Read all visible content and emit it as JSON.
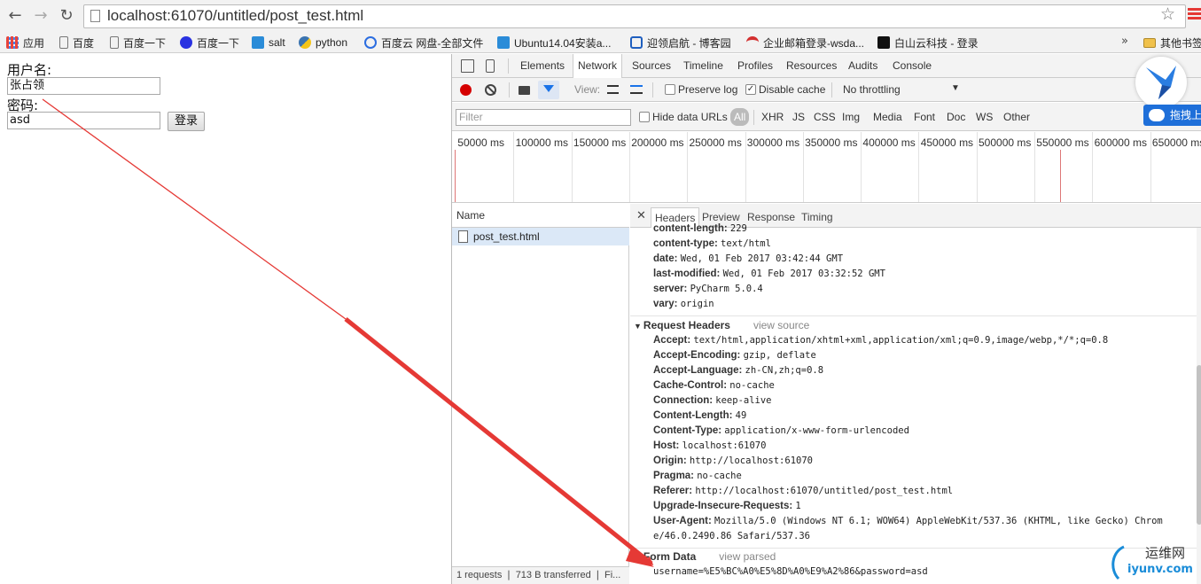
{
  "browser": {
    "url": "localhost:61070/untitled/post_test.html",
    "bookmarks": [
      {
        "label": "应用",
        "icon": "apps-grid-icon",
        "color": "#e8453c"
      },
      {
        "label": "百度",
        "icon": "page-icon",
        "color": "#ffffff"
      },
      {
        "label": "百度一下",
        "icon": "page-icon",
        "color": "#ffffff"
      },
      {
        "label": "百度一下",
        "icon": "baidu-paw-icon",
        "color": "#2932e1"
      },
      {
        "label": "salt",
        "icon": "salt-icon",
        "color": "#2b8cd8"
      },
      {
        "label": "python",
        "icon": "python-icon",
        "color": "#3b74b0"
      },
      {
        "label": "百度云 网盘-全部文件",
        "icon": "baidu-cloud-icon",
        "color": "#2b6de0"
      },
      {
        "label": "Ubuntu14.04安装a...",
        "icon": "ubuntu-icon",
        "color": "#2b8cd8"
      },
      {
        "label": "迎领启航 - 博客园",
        "icon": "blog-icon",
        "color": "#1f5fbf"
      },
      {
        "label": "企业邮箱登录-wsda...",
        "icon": "mail-icon",
        "color": "#d32f2f"
      },
      {
        "label": "白山云科技 - 登录",
        "icon": "baishan-icon",
        "color": "#111111"
      }
    ],
    "more_chevron": "»",
    "other_bookmarks": "其他书签"
  },
  "page": {
    "username_label": "用户名:",
    "username_value": "张占领",
    "password_label": "密码:",
    "password_value": "asd",
    "login_button": "登录"
  },
  "devtools": {
    "tabs": [
      "Elements",
      "Network",
      "Sources",
      "Timeline",
      "Profiles",
      "Resources",
      "Audits",
      "Console"
    ],
    "active_tab": "Network",
    "view_label": "View:",
    "preserve_log": "Preserve log",
    "disable_cache": "Disable cache",
    "throttling": "No throttling",
    "filter_placeholder": "Filter",
    "hide_data_urls": "Hide data URLs",
    "types": [
      "All",
      "XHR",
      "JS",
      "CSS",
      "Img",
      "Media",
      "Font",
      "Doc",
      "WS",
      "Other"
    ],
    "timeline_ticks": [
      "50000 ms",
      "100000 ms",
      "150000 ms",
      "200000 ms",
      "250000 ms",
      "300000 ms",
      "350000 ms",
      "400000 ms",
      "450000 ms",
      "500000 ms",
      "550000 ms",
      "600000 ms",
      "650000 ms"
    ],
    "name_header": "Name",
    "requests": [
      "post_test.html"
    ],
    "status": "1 requests ❘ 713 B transferred ❘ Fi...",
    "detail_tabs": [
      "Headers",
      "Preview",
      "Response",
      "Timing"
    ],
    "response_headers": [
      {
        "key": "content-length:",
        "value": "229"
      },
      {
        "key": "content-type:",
        "value": "text/html"
      },
      {
        "key": "date:",
        "value": "Wed, 01 Feb 2017 03:42:44 GMT"
      },
      {
        "key": "last-modified:",
        "value": "Wed, 01 Feb 2017 03:32:52 GMT"
      },
      {
        "key": "server:",
        "value": "PyCharm 5.0.4"
      },
      {
        "key": "vary:",
        "value": "origin"
      }
    ],
    "request_headers_title": "Request Headers",
    "view_source": "view source",
    "request_headers": [
      {
        "key": "Accept:",
        "value": "text/html,application/xhtml+xml,application/xml;q=0.9,image/webp,*/*;q=0.8"
      },
      {
        "key": "Accept-Encoding:",
        "value": "gzip, deflate"
      },
      {
        "key": "Accept-Language:",
        "value": "zh-CN,zh;q=0.8"
      },
      {
        "key": "Cache-Control:",
        "value": "no-cache"
      },
      {
        "key": "Connection:",
        "value": "keep-alive"
      },
      {
        "key": "Content-Length:",
        "value": "49"
      },
      {
        "key": "Content-Type:",
        "value": "application/x-www-form-urlencoded"
      },
      {
        "key": "Host:",
        "value": "localhost:61070"
      },
      {
        "key": "Origin:",
        "value": "http://localhost:61070"
      },
      {
        "key": "Pragma:",
        "value": "no-cache"
      },
      {
        "key": "Referer:",
        "value": "http://localhost:61070/untitled/post_test.html"
      },
      {
        "key": "Upgrade-Insecure-Requests:",
        "value": "1"
      },
      {
        "key": "User-Agent:",
        "value": "Mozilla/5.0 (Windows NT 6.1; WOW64) AppleWebKit/537.36 (KHTML, like Gecko) Chrom"
      }
    ],
    "user_agent_cont": "e/46.0.2490.86 Safari/537.36",
    "form_data_title": "Form Data",
    "view_parsed": "view parsed",
    "form_data": "username=%E5%BC%A0%E5%8D%A0%E9%A2%86&password=asd"
  },
  "overlay": {
    "drag_button": "拖拽上传",
    "watermark_cn": "运维网",
    "watermark_url": "iyunv.com"
  },
  "colors": {
    "arrow": "#e53935",
    "accent_blue": "#1a73e8",
    "selected_row": "#dbe8f7",
    "record": "#d50000"
  }
}
